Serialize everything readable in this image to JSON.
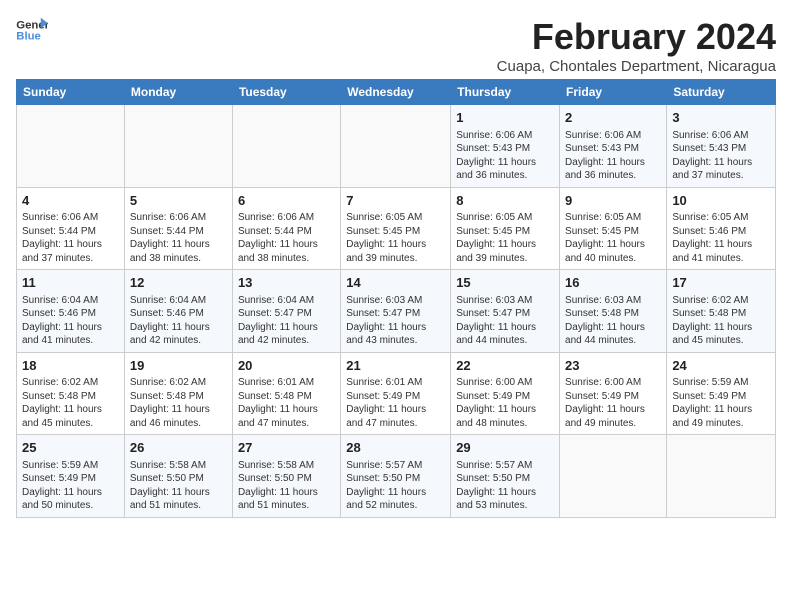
{
  "logo": {
    "line1": "General",
    "line2": "Blue"
  },
  "title": "February 2024",
  "location": "Cuapa, Chontales Department, Nicaragua",
  "days_of_week": [
    "Sunday",
    "Monday",
    "Tuesday",
    "Wednesday",
    "Thursday",
    "Friday",
    "Saturday"
  ],
  "weeks": [
    [
      {
        "day": "",
        "content": ""
      },
      {
        "day": "",
        "content": ""
      },
      {
        "day": "",
        "content": ""
      },
      {
        "day": "",
        "content": ""
      },
      {
        "day": "1",
        "content": "Sunrise: 6:06 AM\nSunset: 5:43 PM\nDaylight: 11 hours\nand 36 minutes."
      },
      {
        "day": "2",
        "content": "Sunrise: 6:06 AM\nSunset: 5:43 PM\nDaylight: 11 hours\nand 36 minutes."
      },
      {
        "day": "3",
        "content": "Sunrise: 6:06 AM\nSunset: 5:43 PM\nDaylight: 11 hours\nand 37 minutes."
      }
    ],
    [
      {
        "day": "4",
        "content": "Sunrise: 6:06 AM\nSunset: 5:44 PM\nDaylight: 11 hours\nand 37 minutes."
      },
      {
        "day": "5",
        "content": "Sunrise: 6:06 AM\nSunset: 5:44 PM\nDaylight: 11 hours\nand 38 minutes."
      },
      {
        "day": "6",
        "content": "Sunrise: 6:06 AM\nSunset: 5:44 PM\nDaylight: 11 hours\nand 38 minutes."
      },
      {
        "day": "7",
        "content": "Sunrise: 6:05 AM\nSunset: 5:45 PM\nDaylight: 11 hours\nand 39 minutes."
      },
      {
        "day": "8",
        "content": "Sunrise: 6:05 AM\nSunset: 5:45 PM\nDaylight: 11 hours\nand 39 minutes."
      },
      {
        "day": "9",
        "content": "Sunrise: 6:05 AM\nSunset: 5:45 PM\nDaylight: 11 hours\nand 40 minutes."
      },
      {
        "day": "10",
        "content": "Sunrise: 6:05 AM\nSunset: 5:46 PM\nDaylight: 11 hours\nand 41 minutes."
      }
    ],
    [
      {
        "day": "11",
        "content": "Sunrise: 6:04 AM\nSunset: 5:46 PM\nDaylight: 11 hours\nand 41 minutes."
      },
      {
        "day": "12",
        "content": "Sunrise: 6:04 AM\nSunset: 5:46 PM\nDaylight: 11 hours\nand 42 minutes."
      },
      {
        "day": "13",
        "content": "Sunrise: 6:04 AM\nSunset: 5:47 PM\nDaylight: 11 hours\nand 42 minutes."
      },
      {
        "day": "14",
        "content": "Sunrise: 6:03 AM\nSunset: 5:47 PM\nDaylight: 11 hours\nand 43 minutes."
      },
      {
        "day": "15",
        "content": "Sunrise: 6:03 AM\nSunset: 5:47 PM\nDaylight: 11 hours\nand 44 minutes."
      },
      {
        "day": "16",
        "content": "Sunrise: 6:03 AM\nSunset: 5:48 PM\nDaylight: 11 hours\nand 44 minutes."
      },
      {
        "day": "17",
        "content": "Sunrise: 6:02 AM\nSunset: 5:48 PM\nDaylight: 11 hours\nand 45 minutes."
      }
    ],
    [
      {
        "day": "18",
        "content": "Sunrise: 6:02 AM\nSunset: 5:48 PM\nDaylight: 11 hours\nand 45 minutes."
      },
      {
        "day": "19",
        "content": "Sunrise: 6:02 AM\nSunset: 5:48 PM\nDaylight: 11 hours\nand 46 minutes."
      },
      {
        "day": "20",
        "content": "Sunrise: 6:01 AM\nSunset: 5:48 PM\nDaylight: 11 hours\nand 47 minutes."
      },
      {
        "day": "21",
        "content": "Sunrise: 6:01 AM\nSunset: 5:49 PM\nDaylight: 11 hours\nand 47 minutes."
      },
      {
        "day": "22",
        "content": "Sunrise: 6:00 AM\nSunset: 5:49 PM\nDaylight: 11 hours\nand 48 minutes."
      },
      {
        "day": "23",
        "content": "Sunrise: 6:00 AM\nSunset: 5:49 PM\nDaylight: 11 hours\nand 49 minutes."
      },
      {
        "day": "24",
        "content": "Sunrise: 5:59 AM\nSunset: 5:49 PM\nDaylight: 11 hours\nand 49 minutes."
      }
    ],
    [
      {
        "day": "25",
        "content": "Sunrise: 5:59 AM\nSunset: 5:49 PM\nDaylight: 11 hours\nand 50 minutes."
      },
      {
        "day": "26",
        "content": "Sunrise: 5:58 AM\nSunset: 5:50 PM\nDaylight: 11 hours\nand 51 minutes."
      },
      {
        "day": "27",
        "content": "Sunrise: 5:58 AM\nSunset: 5:50 PM\nDaylight: 11 hours\nand 51 minutes."
      },
      {
        "day": "28",
        "content": "Sunrise: 5:57 AM\nSunset: 5:50 PM\nDaylight: 11 hours\nand 52 minutes."
      },
      {
        "day": "29",
        "content": "Sunrise: 5:57 AM\nSunset: 5:50 PM\nDaylight: 11 hours\nand 53 minutes."
      },
      {
        "day": "",
        "content": ""
      },
      {
        "day": "",
        "content": ""
      }
    ]
  ]
}
